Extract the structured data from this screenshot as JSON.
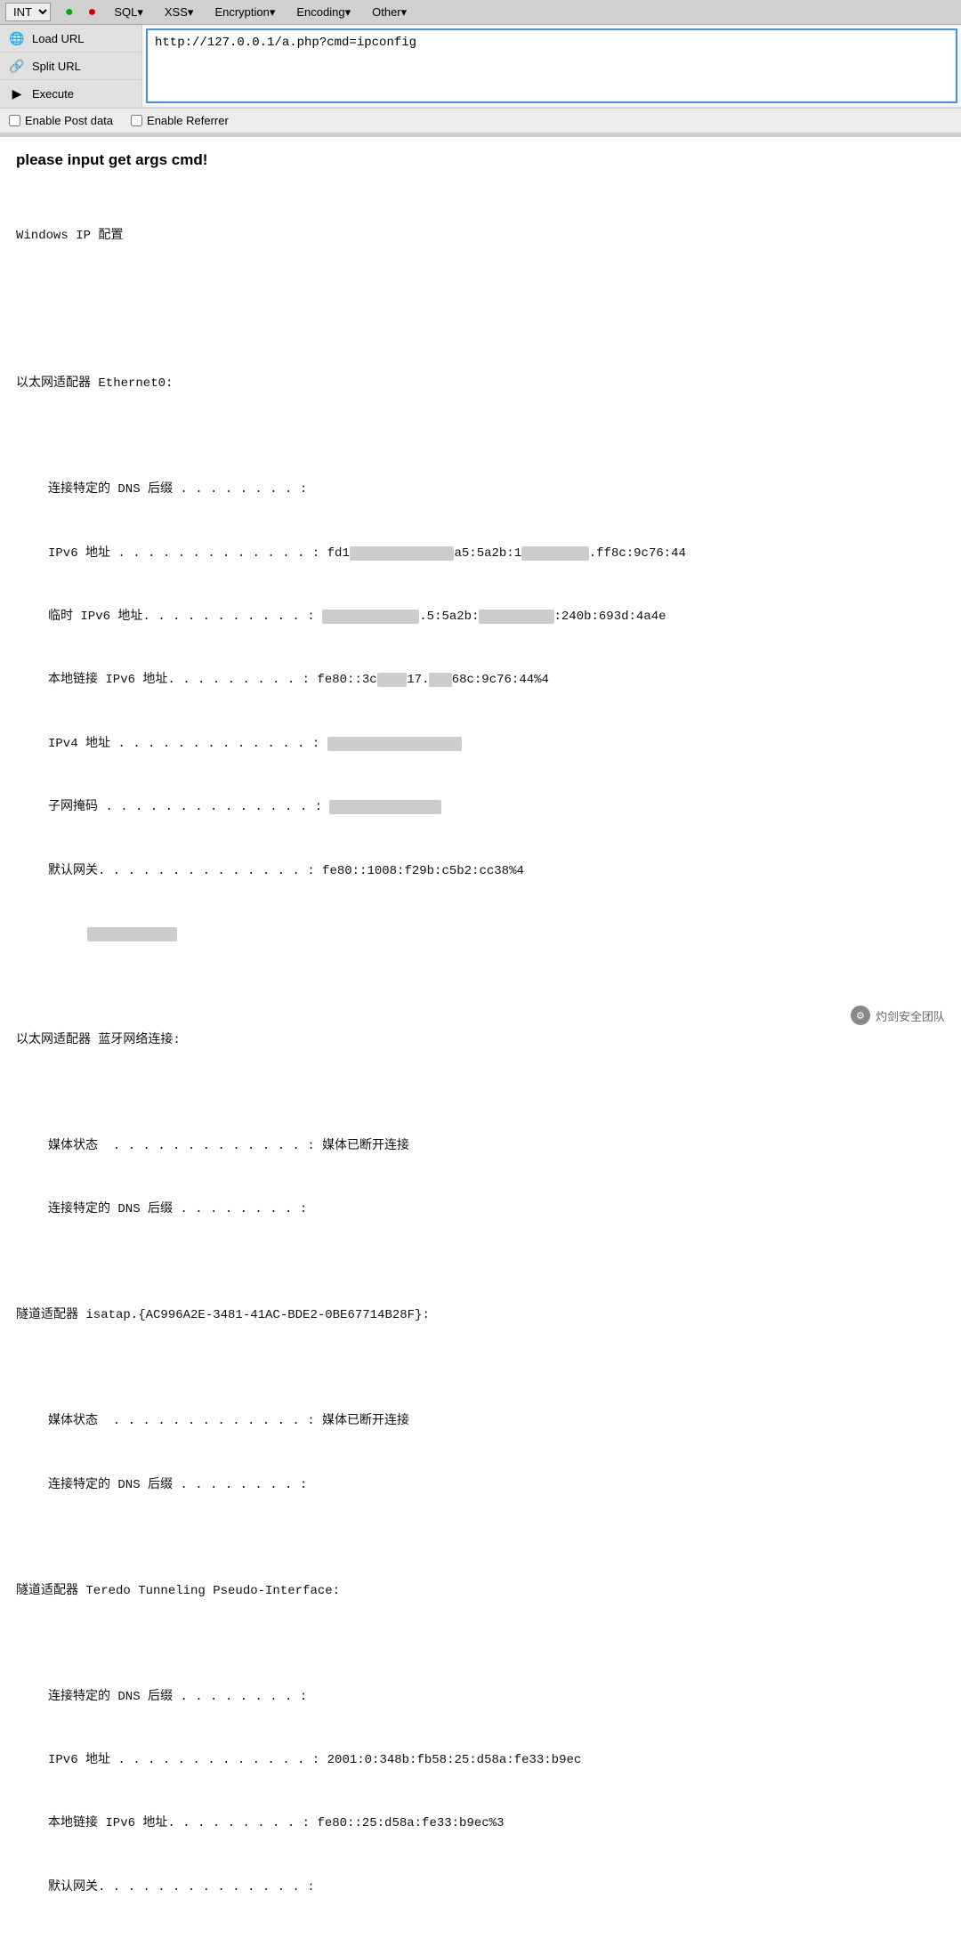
{
  "topbar": {
    "int_label": "INT",
    "items": [
      "SQL▾",
      "XSS▾",
      "Encryption▾",
      "Encoding▾",
      "Other▾"
    ]
  },
  "toolbar": {
    "load_url_label": "Load URL",
    "split_url_label": "Split URL",
    "execute_label": "Execute",
    "url_value": "http://127.0.0.1/a.php?cmd=ipconfig",
    "enable_post": "Enable Post data",
    "enable_referrer": "Enable Referrer"
  },
  "result": {
    "header": "please input get args cmd!",
    "output_lines": [
      {
        "type": "text",
        "content": "Windows IP 配置"
      },
      {
        "type": "blank"
      },
      {
        "type": "blank"
      },
      {
        "type": "section",
        "content": "以太网适配器 Ethernet0:"
      },
      {
        "type": "blank"
      },
      {
        "type": "indent",
        "label": "连接特定的 DNS 后缀 . . . . . . . . :",
        "value": "",
        "blurred": false
      },
      {
        "type": "indent",
        "label": "IPv6 地址 . . . . . . . . . . . . . :",
        "value": "fd1",
        "blurred_part": "a5:5a2b:1",
        "value2": "",
        "blurred_part2": ".ff8c:9c76:44",
        "blurred": true
      },
      {
        "type": "indent",
        "label": "临时 IPv6 地址. . . . . . . . . . . :",
        "value": "",
        "blurred_part": ".5:5a2b:",
        "value2": "",
        "blurred_part2": ":240b:693d:4a4e",
        "blurred": true
      },
      {
        "type": "indent",
        "label": "本地链接 IPv6 地址. . . . . . . . . :",
        "value": "fe80::3c",
        "blurred_part": "17.",
        "value2": "68c:9c76:44%4",
        "blurred": true
      },
      {
        "type": "indent",
        "label": "IPv4 地址 . . . . . . . . . . . . . :",
        "value": "",
        "blurred_part": "blurred_ipv4",
        "blurred": true
      },
      {
        "type": "indent",
        "label": "子网掩码 . . . . . . . . . . . . . . :",
        "value": "",
        "blurred_part": "blurred_mask",
        "blurred": true
      },
      {
        "type": "indent",
        "label": "默认网关. . . . . . . . . . . . . . :",
        "value": "fe80::1008:f29b:c5b2:cc38%4",
        "blurred": false
      },
      {
        "type": "indent_extra",
        "value": "",
        "blurred_part": "blurred_gw2",
        "blurred": true
      },
      {
        "type": "blank"
      },
      {
        "type": "section",
        "content": "以太网适配器 蓝牙网络连接:"
      },
      {
        "type": "blank"
      },
      {
        "type": "indent",
        "label": "媒体状态  . . . . . . . . . . . . . :",
        "value": "媒体已断开连接",
        "blurred": false
      },
      {
        "type": "indent",
        "label": "连接特定的 DNS 后缀 . . . . . . . . :",
        "value": "",
        "blurred": false
      },
      {
        "type": "blank"
      },
      {
        "type": "section",
        "content": "隧道适配器 isatap.{AC996A2E-3481-41AC-BDE2-0BE67714B28F}:"
      },
      {
        "type": "blank"
      },
      {
        "type": "indent",
        "label": "媒体状态  . . . . . . . . . . . . . :",
        "value": "媒体已断开连接",
        "blurred": false
      },
      {
        "type": "indent",
        "label": "连接特定的 DNS 后缀 . . . . . . . . :",
        "value": "",
        "blurred": false
      },
      {
        "type": "blank"
      },
      {
        "type": "section",
        "content": "隧道适配器 Teredo Tunneling Pseudo-Interface:"
      },
      {
        "type": "blank"
      },
      {
        "type": "indent",
        "label": "连接特定的 DNS 后缀 . . . . . . . . :",
        "value": "",
        "blurred": false
      },
      {
        "type": "indent",
        "label": "IPv6 地址 . . . . . . . . . . . . . :",
        "value": "2001:0:348b:fb58:25:d58a:fe33:b9ec",
        "blurred": false
      },
      {
        "type": "indent",
        "label": "本地链接 IPv6 地址. . . . . . . . . :",
        "value": "fe80::25:d58a:fe33:b9ec%3",
        "blurred": false
      },
      {
        "type": "indent",
        "label": "默认网关. . . . . . . . . . . . . . :",
        "value": "",
        "blurred": false
      }
    ]
  },
  "watermark": {
    "text": "灼剑安全团队",
    "icon": "⚙"
  }
}
